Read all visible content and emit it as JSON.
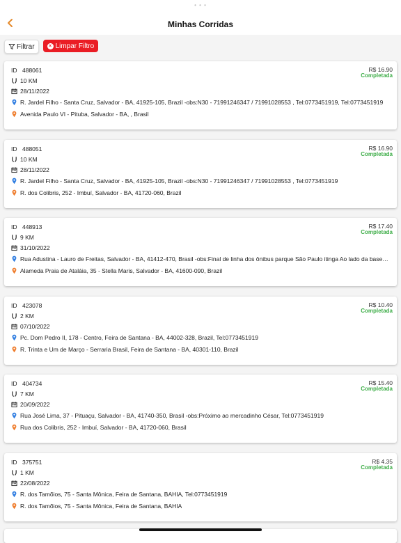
{
  "header": {
    "title": "Minhas Corridas"
  },
  "filters": {
    "filter_label": "Filtrar",
    "clear_label": "Limpar Filtro"
  },
  "colors": {
    "accent": "#ea1d25",
    "status": "#3fae49",
    "origin_pin": "#2f7de1",
    "dest_pin": "#ef7d2d",
    "back": "#e58a2c"
  },
  "id_label": "ID",
  "rides": [
    {
      "id": "488061",
      "distance": "10 KM",
      "date": "28/11/2022",
      "price": "R$ 16.90",
      "status": "Completada",
      "origin": "R. Jardel Filho - Santa Cruz, Salvador - BA, 41925-105, Brazil -obs:N30 - 71991246347 / 71991028553 , Tel:0773451919, Tel:0773451919",
      "destination": "Avenida Paulo VI - Pituba, Salvador - BA, , Brasil"
    },
    {
      "id": "488051",
      "distance": "10 KM",
      "date": "28/11/2022",
      "price": "R$ 16.90",
      "status": "Completada",
      "origin": "R. Jardel Filho - Santa Cruz, Salvador - BA, 41925-105, Brazil -obs:N30   -   71991246347 / 71991028553 , Tel:0773451919",
      "destination": "R. dos Colibris, 252 - Imbuí, Salvador - BA, 41720-060, Brazil"
    },
    {
      "id": "448913",
      "distance": "9 KM",
      "date": "31/10/2022",
      "price": "R$ 17.40",
      "status": "Completada",
      "origin": "Rua Adustina - Lauro de Freitas, Salvador - BA, 41412-470, Brasil -obs:Final de linha dos ônibus parque São Paulo itinga Ao lado da base 81...",
      "destination": "Alameda Praia de Ataláia, 35 - Stella Maris, Salvador - BA, 41600-090, Brazil"
    },
    {
      "id": "423078",
      "distance": "2 KM",
      "date": "07/10/2022",
      "price": "R$ 10.40",
      "status": "Completada",
      "origin": "Pc. Dom Pedro II, 178 - Centro, Feira de Santana - BA, 44002-328, Brazil, Tel:0773451919",
      "destination": "R. Trinta e Um de Março - Serraria Brasil, Feira de Santana - BA, 40301-110, Brazil"
    },
    {
      "id": "404734",
      "distance": "7 KM",
      "date": "20/09/2022",
      "price": "R$ 15.40",
      "status": "Completada",
      "origin": "Rua José Lima, 37 - Pituaçu, Salvador - BA, 41740-350, Brasil -obs:Próximo ao mercadinho César, Tel:0773451919",
      "destination": "Rua dos Colibris, 252 - Imbuí, Salvador - BA, 41720-060, Brasil"
    },
    {
      "id": "375751",
      "distance": "1 KM",
      "date": "22/08/2022",
      "price": "R$ 4.35",
      "status": "Completada",
      "origin": "R. dos Tamõios, 75 - Santa Mônica, Feira de Santana, BAHIA, Tel:0773451919",
      "destination": "R. dos Tamõios, 75 - Santa Mônica, Feira de Santana, BAHIA"
    }
  ]
}
